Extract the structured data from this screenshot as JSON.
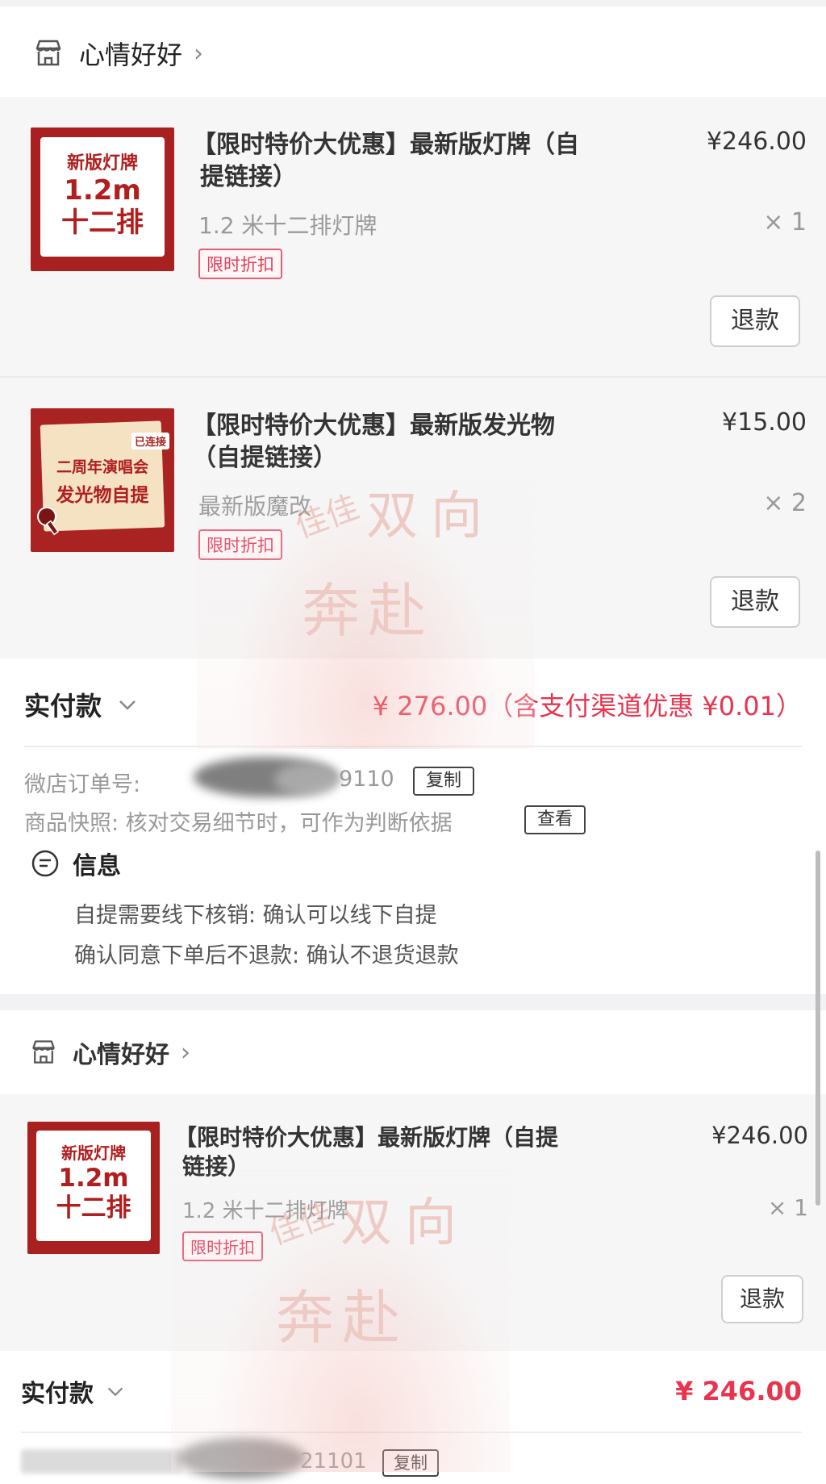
{
  "order1": {
    "shop_name": "心情好好",
    "items": [
      {
        "title": "【限时特价大优惠】最新版灯牌（自提链接）",
        "title_line1": "【限时特价大优惠】最新版灯牌（自",
        "title_line2": "提链接）",
        "spec": "1.2 米十二排灯牌",
        "tag": "限时折扣",
        "price": "¥246.00",
        "qty": "× 1",
        "refund_label": "退款",
        "thumb": {
          "line1": "新版灯牌",
          "line2": "1.2m",
          "line3": "十二排"
        }
      },
      {
        "title": "【限时特价大优惠】最新版发光物（自提链接）",
        "title_line1": "【限时特价大优惠】最新版发光物",
        "title_line2": "（自提链接）",
        "spec": "最新版魔改",
        "tag": "限时折扣",
        "price": "¥15.00",
        "qty": "× 2",
        "refund_label": "退款",
        "thumb": {
          "badge": "已连接",
          "line1": "二周年演唱会",
          "line2": "发光物自提"
        }
      }
    ],
    "paid_label": "实付款",
    "paid_amount": "¥ 276.00（含支付渠道优惠 ¥0.01）",
    "order_no_label": "微店订单号:",
    "order_no_suffix": "9110",
    "copy_label": "复制",
    "snapshot_text": "商品快照: 核对交易细节时，可作为判断依据",
    "view_label": "查看"
  },
  "info": {
    "title": "信息",
    "lines": [
      "自提需要线下核销: 确认可以线下自提",
      "确认同意下单后不退款: 确认不退货退款"
    ]
  },
  "order2": {
    "shop_name": "心情好好",
    "item": {
      "title_line1": "【限时特价大优惠】最新版灯牌（自提",
      "title_line2": "链接）",
      "spec": "1.2 米十二排灯牌",
      "tag": "限时折扣",
      "price": "¥246.00",
      "qty": "× 1",
      "refund_label": "退款",
      "thumb": {
        "line1": "新版灯牌",
        "line2": "1.2m",
        "line3": "十二排"
      }
    },
    "paid_label": "实付款",
    "paid_amount": "¥ 246.00",
    "order_no_suffix": "21101",
    "copy_label": "复制"
  },
  "watermark": {
    "text1": "佳佳",
    "text2": "双向",
    "text3": "奔赴"
  },
  "colors": {
    "accent": "#e8344f",
    "tag": "#e0405c",
    "thumb_red": "#a8201f"
  }
}
